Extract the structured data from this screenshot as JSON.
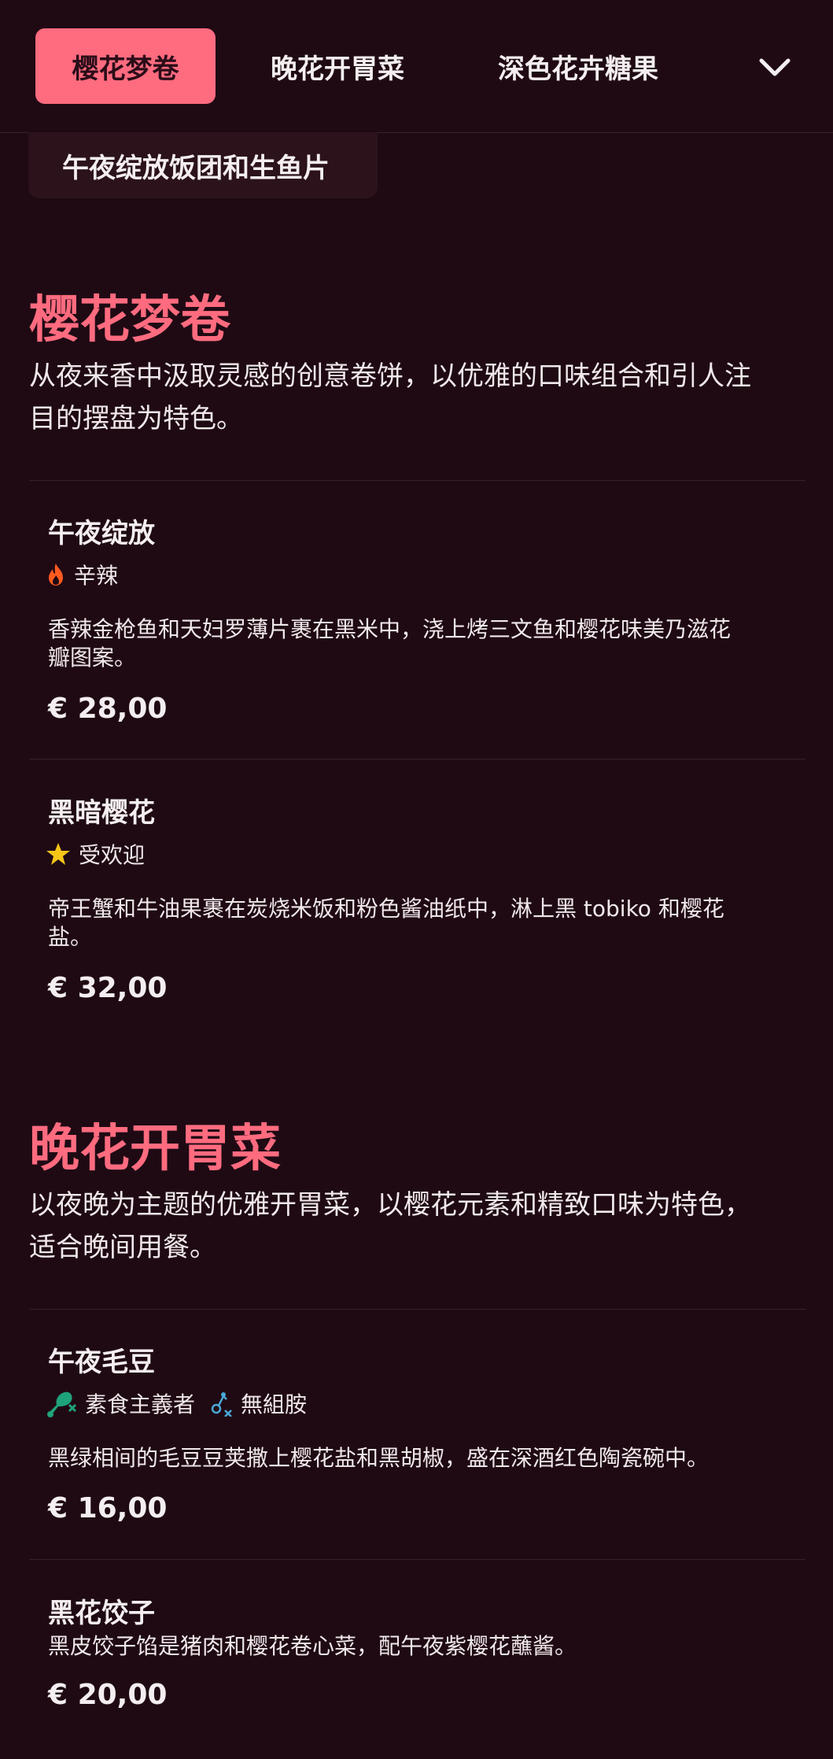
{
  "nav": {
    "tabs": [
      {
        "label": "樱花梦卷",
        "active": true
      },
      {
        "label": "晚花开胃菜",
        "active": false
      },
      {
        "label": "深色花卉糖果",
        "active": false
      }
    ],
    "more_icon": "chevron-down-icon"
  },
  "subtab": {
    "label": "午夜绽放饭团和生鱼片"
  },
  "sections": [
    {
      "title": "樱花梦卷",
      "description_line1": "从夜来香中汲取灵感的创意卷饼，以优雅的口味组合和引人注",
      "description_line2": "目的摆盘为特色。",
      "items": [
        {
          "name": "午夜绽放",
          "tags": [
            {
              "icon": "flame-icon",
              "label": "辛辣"
            }
          ],
          "description_line1": "香辣金枪鱼和天妇罗薄片裹在黑米中，浇上烤三文鱼和樱花味美乃滋花",
          "description_line2": "瓣图案。",
          "price": "€ 28,00"
        },
        {
          "name": "黑暗樱花",
          "tags": [
            {
              "icon": "star-icon",
              "label": "受欢迎"
            }
          ],
          "description_line1": "帝王蟹和牛油果裹在炭烧米饭和粉色酱油纸中，淋上黑 tobiko 和樱花",
          "description_line2": "盐。",
          "price": "€ 32,00"
        }
      ]
    },
    {
      "title": "晚花开胃菜",
      "description_line1": "以夜晚为主题的优雅开胃菜，以樱花元素和精致口味为特色，",
      "description_line2": "适合晚间用餐。",
      "items": [
        {
          "name": "午夜毛豆",
          "tags": [
            {
              "icon": "no-meat-icon",
              "label": "素食主義者"
            },
            {
              "icon": "no-histamine-icon",
              "label": "無組胺"
            }
          ],
          "description_line1": "黑绿相间的毛豆豆荚撒上樱花盐和黑胡椒，盛在深酒红色陶瓷碗中。",
          "price": "€ 16,00"
        },
        {
          "name": "黑花饺子",
          "description_line1": "黑皮饺子馅是猪肉和樱花卷心菜，配午夜紫樱花蘸酱。",
          "price": "€ 20,00"
        }
      ]
    }
  ],
  "colors": {
    "background": "#1f0a14",
    "accent": "#ff6b7f",
    "text": "#f4eef0",
    "flame": "#ff5a1f",
    "star": "#f5c518",
    "vegan": "#1fa37a",
    "histamine": "#4aa8d8"
  }
}
